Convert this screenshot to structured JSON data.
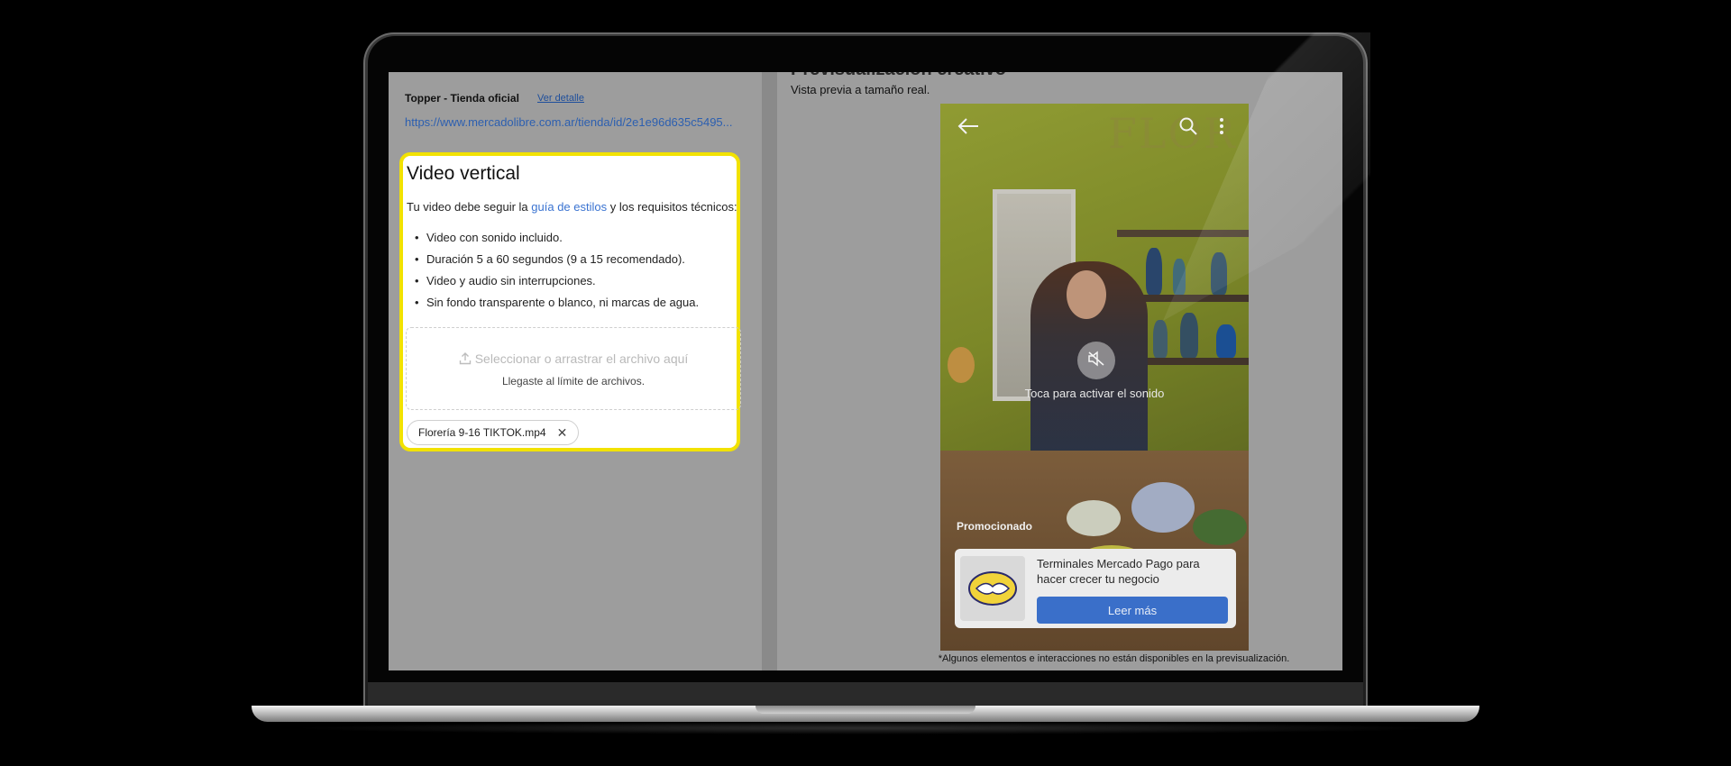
{
  "left": {
    "store_name": "Topper - Tienda oficial",
    "store_link": "Ver detalle",
    "store_url": "https://www.mercadolibre.com.ar/tienda/id/2e1e96d635c5495..."
  },
  "video_card": {
    "title": "Video vertical",
    "intro_before": "Tu video debe seguir la ",
    "intro_link": "guía de estilos",
    "intro_after": " y los requisitos técnicos:",
    "requirements": [
      "Video con sonido incluido.",
      "Duración 5 a 60 segundos (9 a 15 recomendado).",
      "Video y audio sin interrupciones.",
      "Sin fondo transparente o blanco, ni marcas de agua."
    ],
    "dropzone_label": "Seleccionar o arrastrar el archivo aquí",
    "dropzone_sub": "Llegaste al límite de archivos.",
    "file_name": "Florería 9-16 TIKTOK.mp4"
  },
  "preview": {
    "title": "Previsualización creativo",
    "subtitle": "Vista previa a tamaño real.",
    "brand_text": "FLOR",
    "mute_text": "Toca para activar el sonido",
    "promo_label": "Promocionado",
    "ad_text": "Terminales Mercado Pago para hacer crecer tu negocio",
    "ad_button": "Leer más",
    "note": "*Algunos elementos e interacciones no están disponibles en la previsualización."
  },
  "colors": {
    "highlight": "#f2e200",
    "link": "#3a73d1",
    "button": "#3a6fc9"
  }
}
